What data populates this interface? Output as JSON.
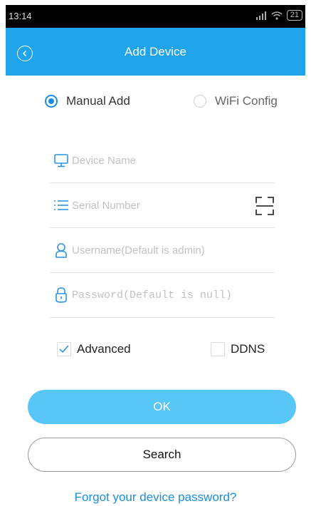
{
  "status_bar": {
    "time": "13:14",
    "battery": "21"
  },
  "nav": {
    "title": "Add Device"
  },
  "mode": {
    "options": [
      {
        "label": "Manual Add",
        "selected": true
      },
      {
        "label": "WiFi Config",
        "selected": false
      }
    ]
  },
  "form": {
    "device_name": {
      "value": "",
      "placeholder": "Device Name"
    },
    "serial_number": {
      "value": "",
      "placeholder": "Serial Number"
    },
    "username": {
      "value": "",
      "placeholder": "Username(Default is admin)"
    },
    "password": {
      "value": "",
      "placeholder": "Password(Default is null)"
    }
  },
  "options": {
    "advanced": {
      "label": "Advanced",
      "checked": true
    },
    "ddns": {
      "label": "DDNS",
      "checked": false
    }
  },
  "buttons": {
    "ok": "OK",
    "search": "Search"
  },
  "forgot_link": "Forgot your device password?",
  "colors": {
    "accent": "#1fa3ea",
    "ok_button": "#58c6f7",
    "link": "#1a8ee0",
    "icon": "#2a94e6"
  },
  "icons": {
    "back": "chevron-left-circle-icon",
    "device": "monitor-icon",
    "serial": "list-icon",
    "scan": "scan-icon",
    "user": "user-icon",
    "lock": "lock-icon"
  }
}
